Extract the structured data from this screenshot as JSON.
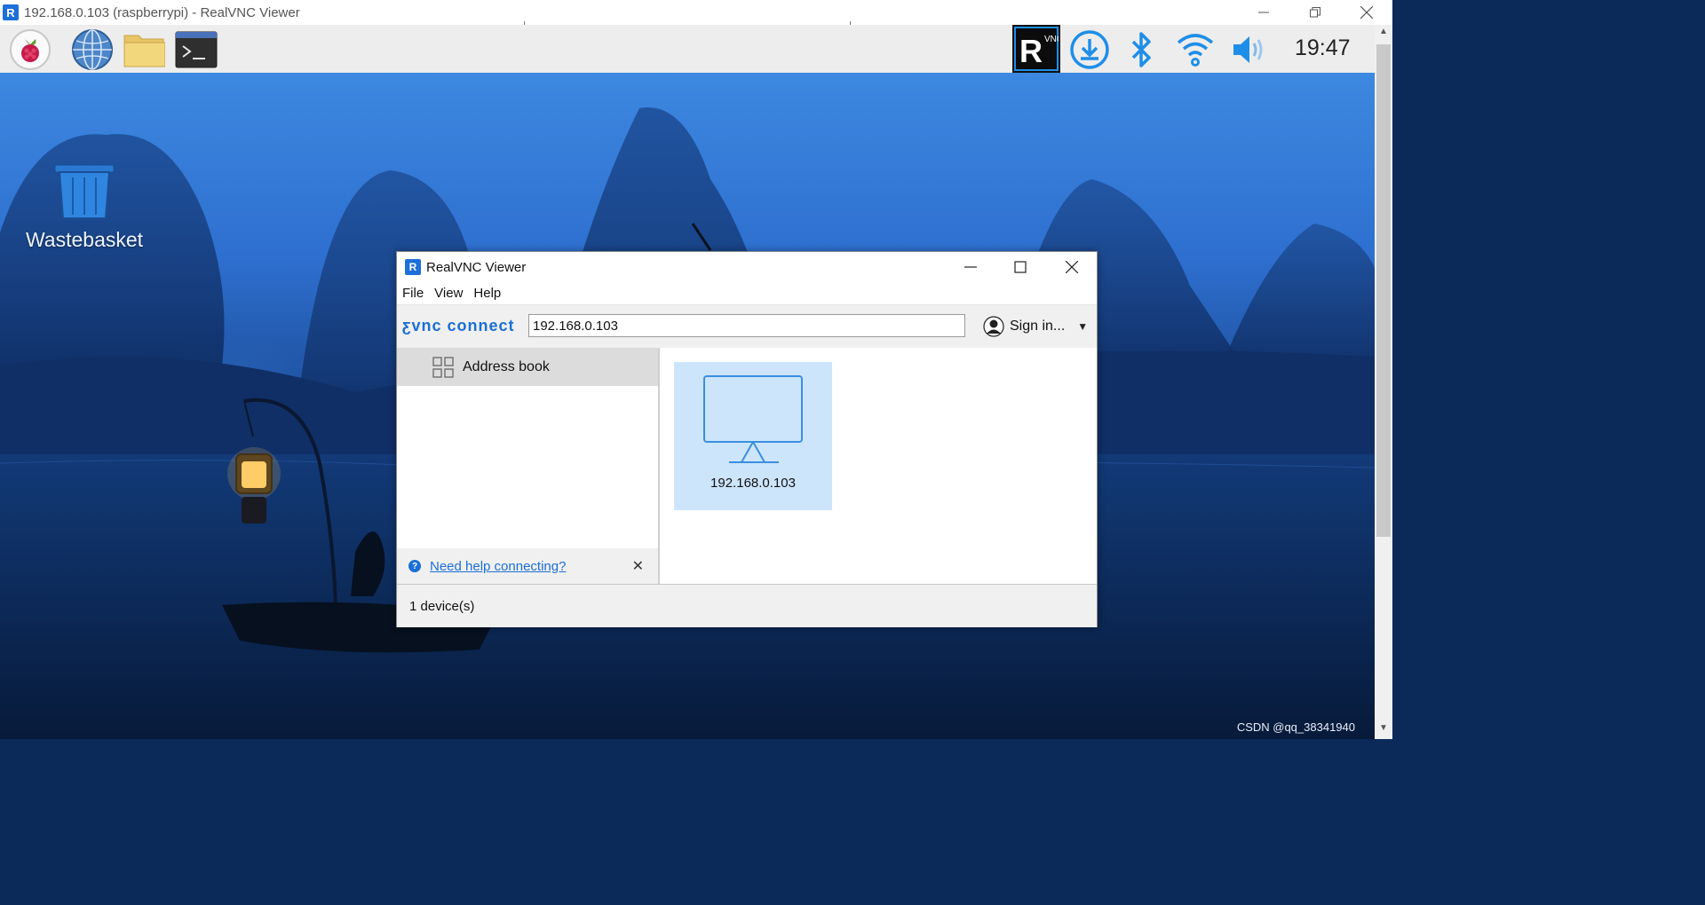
{
  "window": {
    "title": "192.168.0.103 (raspberrypi) - RealVNC Viewer",
    "app_icon_letter": "R"
  },
  "taskbar": {
    "launchers": [
      "raspberry-menu-icon",
      "web-browser-icon",
      "file-manager-icon",
      "terminal-icon"
    ],
    "tray": [
      "vnc-server-icon",
      "updater-icon",
      "bluetooth-icon",
      "wifi-icon",
      "volume-icon"
    ],
    "clock": "19:47",
    "vnc_label": "VNC"
  },
  "desktop": {
    "wastebasket_label": "Wastebasket",
    "watermark": "CSDN @qq_38341940"
  },
  "dialog": {
    "title": "RealVNC Viewer",
    "menu": [
      "File",
      "View",
      "Help"
    ],
    "brand": "ƹvnc connect",
    "address_value": "192.168.0.103",
    "sign_in": "Sign in...",
    "sidebar": {
      "address_book": "Address book",
      "help_link": "Need help connecting?"
    },
    "devices": [
      {
        "name": "192.168.0.103"
      }
    ],
    "status": "1 device(s)"
  },
  "colors": {
    "accent": "#1a6fd6",
    "tray_blue": "#1f8ee8",
    "device_selected_bg": "#cde5fb"
  }
}
